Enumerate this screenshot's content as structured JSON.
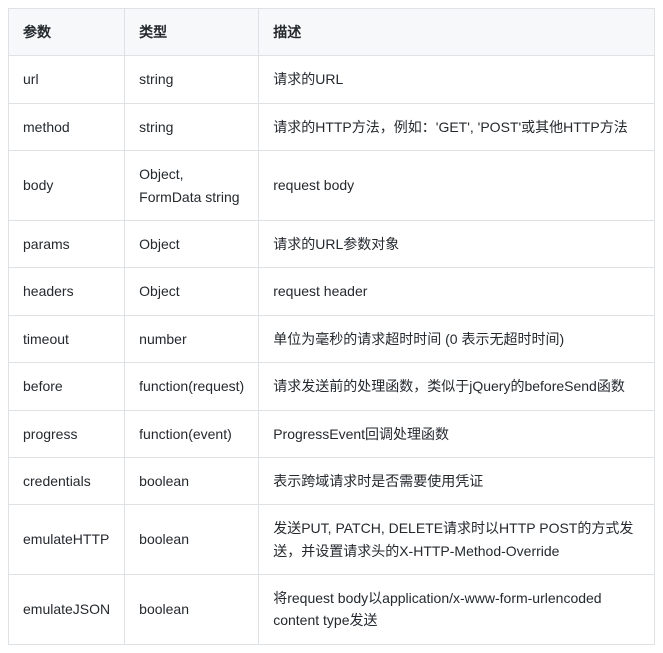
{
  "table": {
    "headers": {
      "param": "参数",
      "type": "类型",
      "desc": "描述"
    },
    "rows": [
      {
        "param": "url",
        "type": "string",
        "desc": "请求的URL"
      },
      {
        "param": "method",
        "type": "string",
        "desc": "请求的HTTP方法，例如：'GET', 'POST'或其他HTTP方法"
      },
      {
        "param": "body",
        "type": "Object, FormData string",
        "desc": "request body"
      },
      {
        "param": "params",
        "type": "Object",
        "desc": "请求的URL参数对象"
      },
      {
        "param": "headers",
        "type": "Object",
        "desc": "request header"
      },
      {
        "param": "timeout",
        "type": "number",
        "desc": "单位为毫秒的请求超时时间 (0 表示无超时时间)"
      },
      {
        "param": "before",
        "type": "function(request)",
        "desc": "请求发送前的处理函数，类似于jQuery的beforeSend函数"
      },
      {
        "param": "progress",
        "type": "function(event)",
        "desc": "ProgressEvent回调处理函数"
      },
      {
        "param": "credentials",
        "type": "boolean",
        "desc": "表示跨域请求时是否需要使用凭证"
      },
      {
        "param": "emulateHTTP",
        "type": "boolean",
        "desc": "发送PUT, PATCH, DELETE请求时以HTTP POST的方式发送，并设置请求头的X-HTTP-Method-Override"
      },
      {
        "param": "emulateJSON",
        "type": "boolean",
        "desc": "将request body以application/x-www-form-urlencoded content type发送"
      }
    ]
  }
}
